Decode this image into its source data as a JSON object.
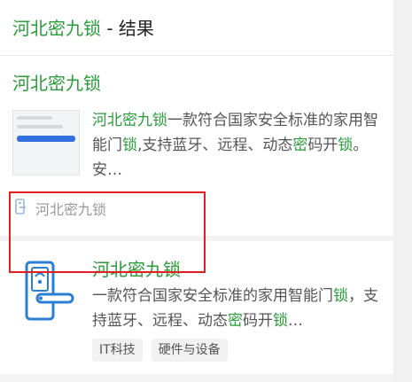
{
  "header": {
    "keyword": "河北密九锁",
    "suffix": " - 结果"
  },
  "card1": {
    "title": "河北密九锁",
    "desc_parts": [
      {
        "text": "河北密九锁",
        "hl": true,
        "strong": true
      },
      {
        "text": "一款符合国家安全标准的家用智能门",
        "hl": false
      },
      {
        "text": "锁",
        "hl": true
      },
      {
        "text": ",支持蓝牙、远程、动态",
        "hl": false
      },
      {
        "text": "密",
        "hl": true
      },
      {
        "text": "码开",
        "hl": false
      },
      {
        "text": "锁",
        "hl": true
      },
      {
        "text": "。安…",
        "hl": false
      }
    ],
    "source_text": "河北密九锁"
  },
  "card2": {
    "title": "河北密九锁",
    "desc_parts": [
      {
        "text": "一款符合国家安全标准的家用智能门",
        "hl": false
      },
      {
        "text": "锁",
        "hl": true
      },
      {
        "text": "，支持蓝牙、远程、动态",
        "hl": false
      },
      {
        "text": "密",
        "hl": true
      },
      {
        "text": "码开",
        "hl": false
      },
      {
        "text": "锁",
        "hl": true
      },
      {
        "text": "…",
        "hl": false
      }
    ],
    "tags": [
      "IT科技",
      "硬件与设备"
    ]
  },
  "colors": {
    "keyword_green": "#2a9d3a",
    "highlight_red": "#e02020",
    "icon_blue": "#2a7fd4"
  },
  "icons": {
    "source": "door-lock-small-icon",
    "app": "smart-door-lock-icon"
  }
}
